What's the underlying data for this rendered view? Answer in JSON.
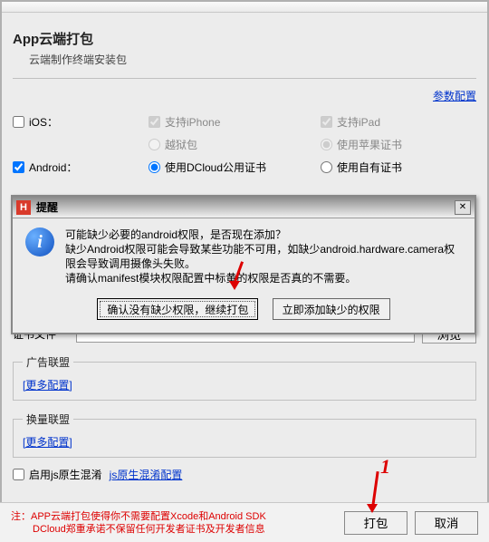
{
  "header": {
    "title": "App云端打包",
    "subtitle": "云端制作终端安装包",
    "config_link": "参数配置"
  },
  "platform": {
    "ios_label": "iOS：",
    "support_iphone": "支持iPhone",
    "support_ipad": "支持iPad",
    "jailbreak": "越狱包",
    "apple_cert": "使用苹果证书",
    "android_label": "Android：",
    "dcloud_cert": "使用DCloud公用证书",
    "own_cert": "使用自有证书"
  },
  "cert": {
    "file_label": "证书文件",
    "browse": "浏览"
  },
  "ads": {
    "legend": "广告联盟",
    "more": "[更多配置]"
  },
  "channel": {
    "legend": "换量联盟",
    "more": "[更多配置]"
  },
  "js": {
    "enable_label": "启用js原生混淆",
    "config_link": "js原生混淆配置"
  },
  "footer": {
    "note_l1": "注：APP云端打包使得你不需要配置Xcode和Android SDK",
    "note_l2": "DCloud郑重承诺不保留任何开发者证书及开发者信息",
    "pack": "打包",
    "cancel": "取消"
  },
  "dialog": {
    "icon_letter": "H",
    "title": "提醒",
    "info_glyph": "i",
    "line1": "可能缺少必要的android权限，是否现在添加？",
    "line2": "缺少Android权限可能会导致某些功能不可用，如缺少android.hardware.camera权限会导致调用摄像头失败。",
    "line3": "请确认manifest模块权限配置中标黄的权限是否真的不需要。",
    "btn_continue": "确认没有缺少权限，继续打包",
    "btn_add": "立即添加缺少的权限"
  },
  "annotation": {
    "num1": "1"
  }
}
